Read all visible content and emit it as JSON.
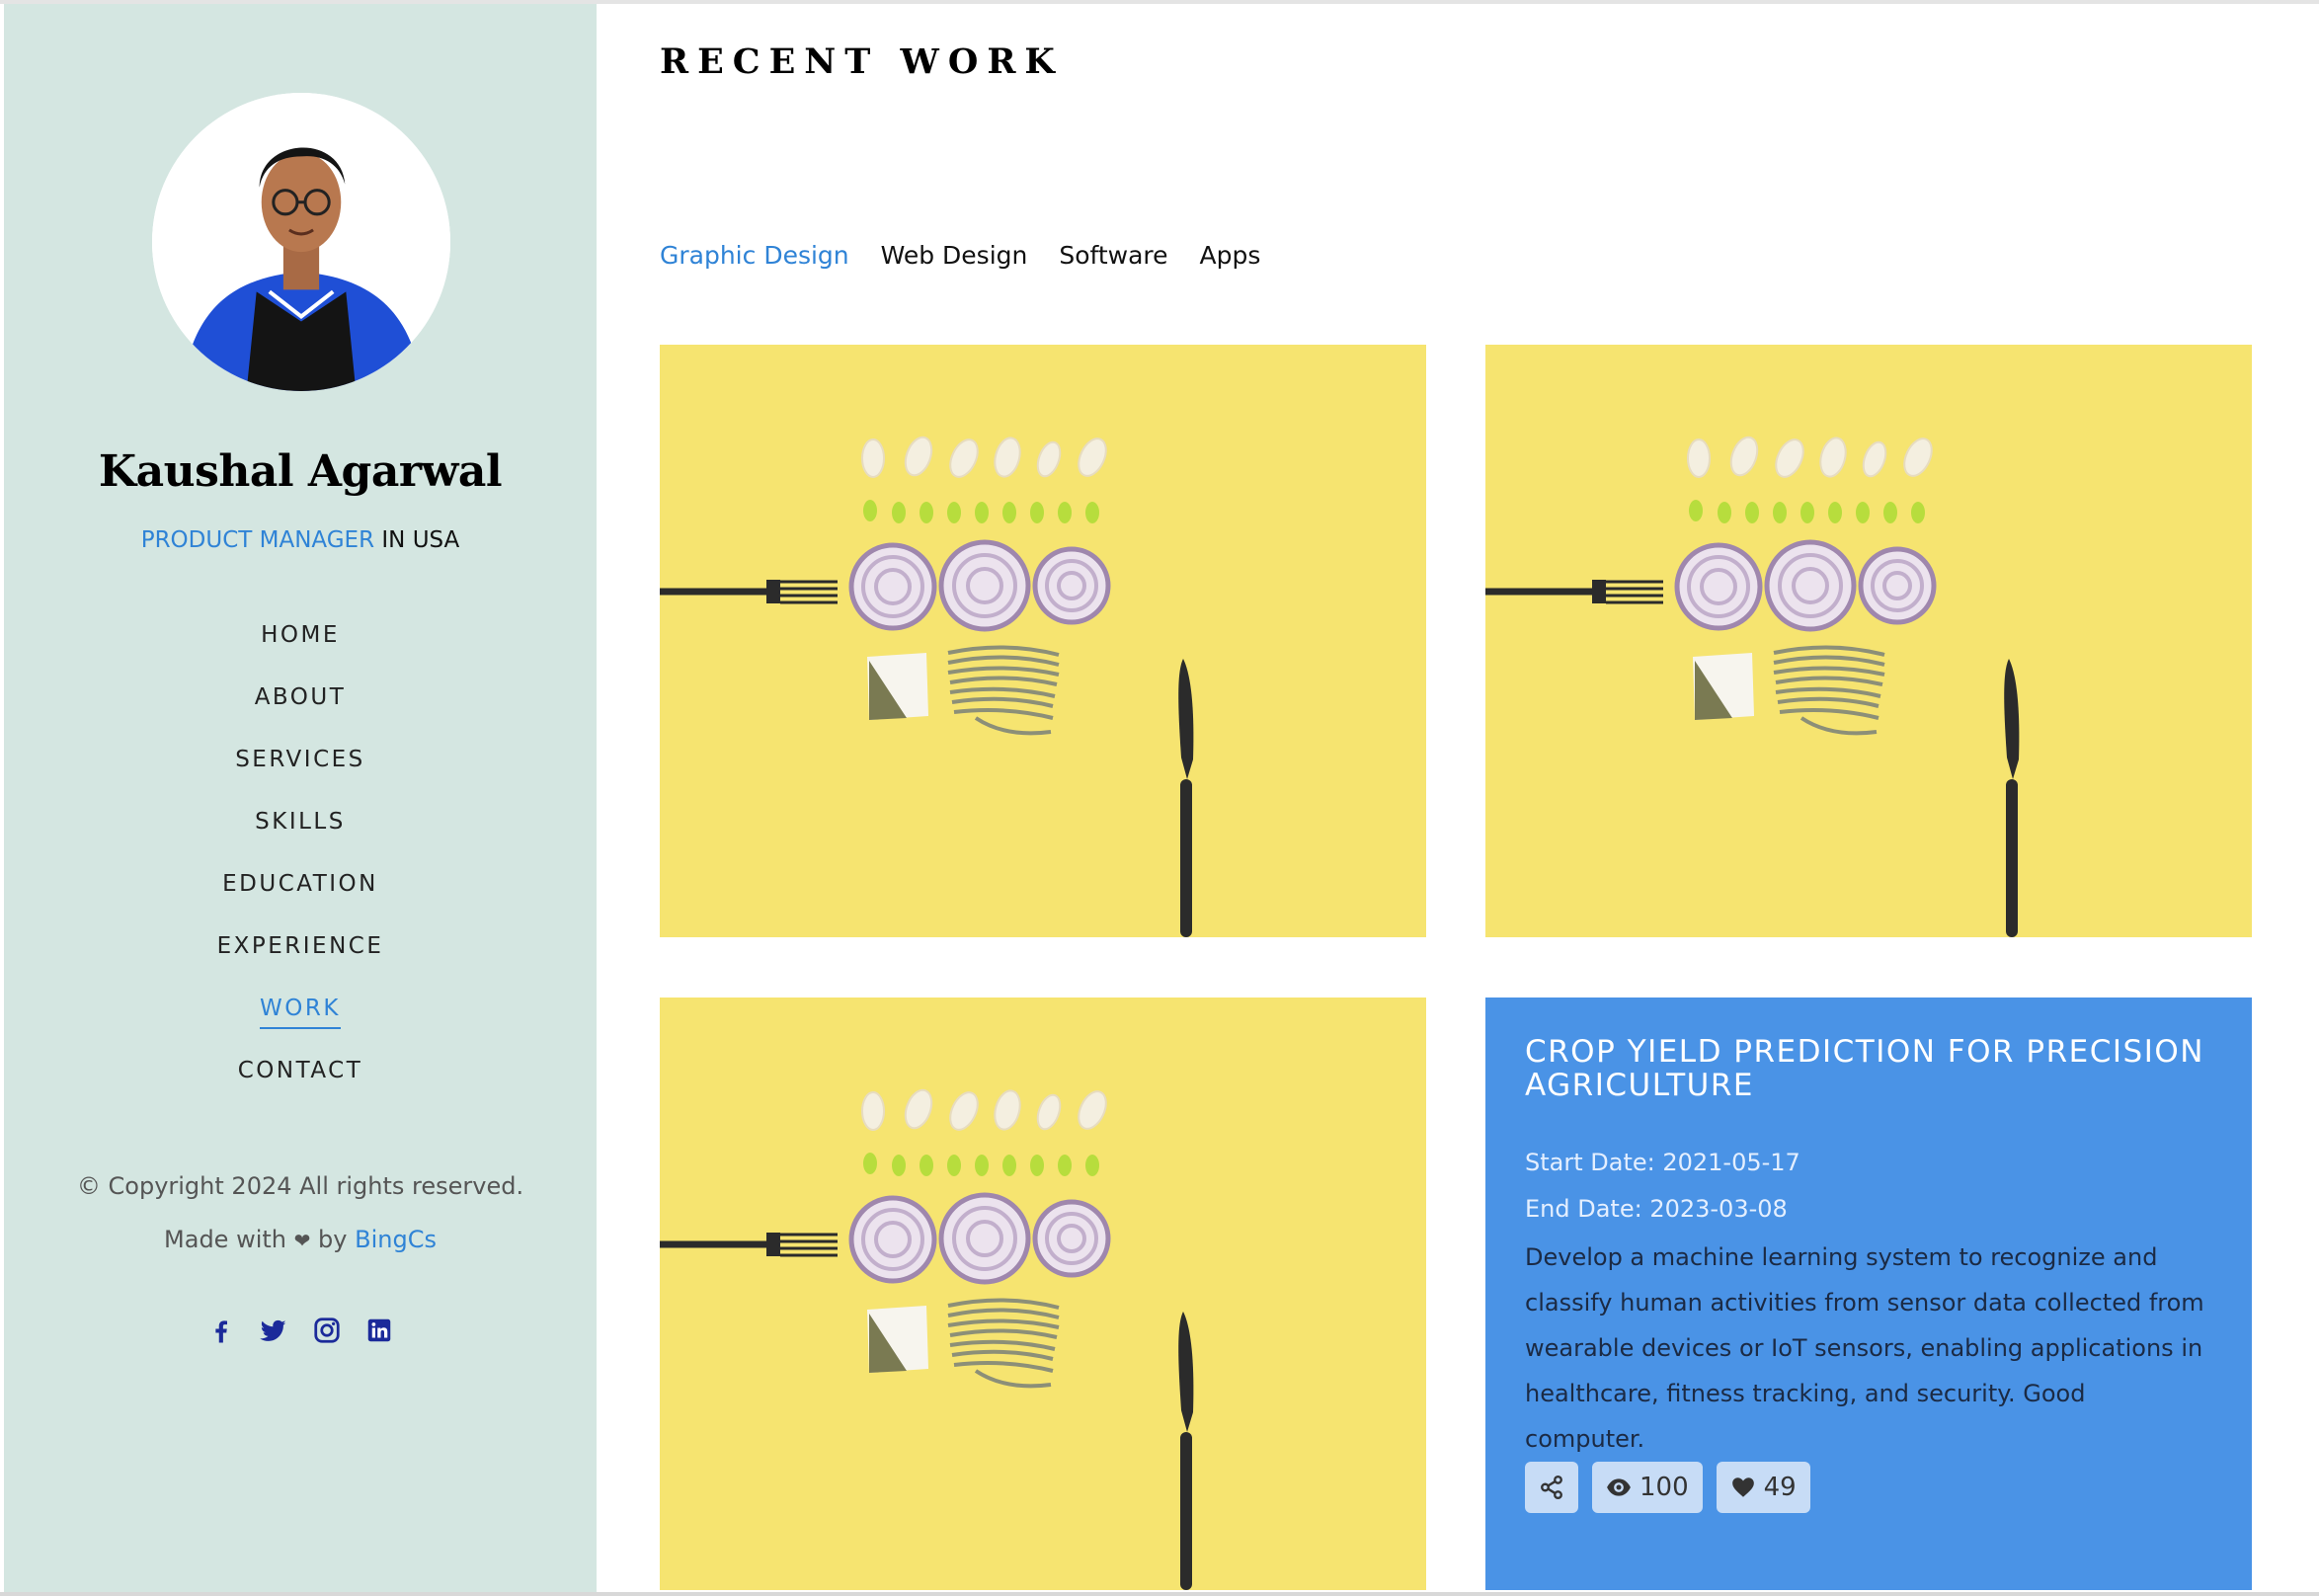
{
  "profile": {
    "name": "Kaushal Agarwal",
    "role": "PRODUCT MANAGER",
    "location_suffix": " IN USA"
  },
  "nav": {
    "items": [
      {
        "label": "HOME"
      },
      {
        "label": "ABOUT"
      },
      {
        "label": "SERVICES"
      },
      {
        "label": "SKILLS"
      },
      {
        "label": "EDUCATION"
      },
      {
        "label": "EXPERIENCE"
      },
      {
        "label": "WORK"
      },
      {
        "label": "CONTACT"
      }
    ],
    "active": "WORK"
  },
  "footer": {
    "copyright_prefix": "© Copyright 2024 All rights reserved. Made with",
    "by": "by",
    "author": "BingCs"
  },
  "social": [
    "facebook-icon",
    "twitter-icon",
    "instagram-icon",
    "linkedin-icon"
  ],
  "main": {
    "title": "RECENT WORK",
    "filters": [
      {
        "label": "Graphic Design"
      },
      {
        "label": "Web Design"
      },
      {
        "label": "Software"
      },
      {
        "label": "Apps"
      }
    ],
    "active_filter": "Graphic Design"
  },
  "project": {
    "title": "CROP YIELD PREDICTION FOR PRECISION AGRICULTURE",
    "start": "Start Date: 2021-05-17",
    "end": "End Date: 2023-03-08",
    "description": "Develop a machine learning system to recognize and classify human activities from sensor data collected from wearable devices or IoT sensors, enabling applications in healthcare, fitness tracking, and security. Good computer.",
    "views": "100",
    "likes": "49"
  },
  "colors": {
    "sidebar_bg": "#d4e6e1",
    "accent": "#2f83d6",
    "card_blue": "#4a93e6",
    "food_yellow": "#f6e470"
  }
}
